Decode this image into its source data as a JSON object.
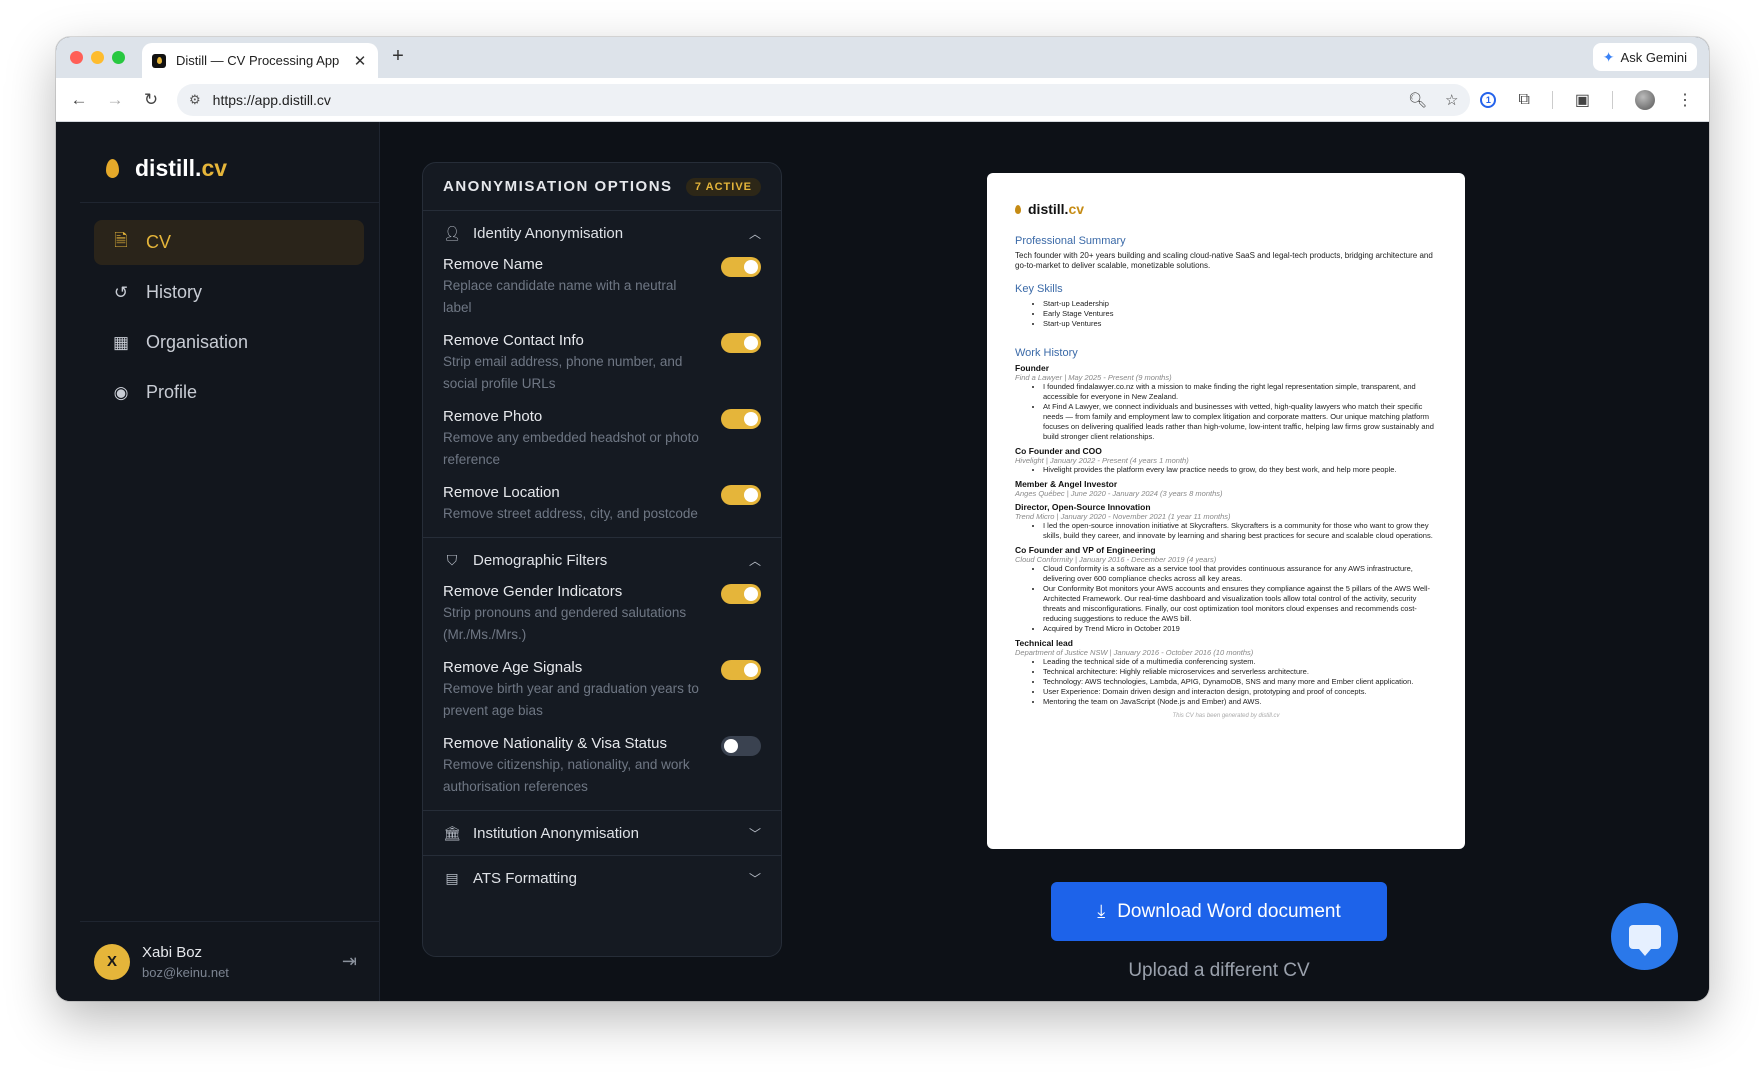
{
  "browser": {
    "tab_title": "Distill — CV Processing App",
    "tab_close": "✕",
    "new_tab": "+",
    "gemini_label": "Ask Gemini",
    "url": "https://app.distill.cv"
  },
  "brand": {
    "name": "distill.",
    "suffix": "cv"
  },
  "sidebar": {
    "items": [
      {
        "label": "CV",
        "icon": "document-icon",
        "active": true
      },
      {
        "label": "History",
        "icon": "history-icon"
      },
      {
        "label": "Organisation",
        "icon": "building-icon"
      },
      {
        "label": "Profile",
        "icon": "user-circle-icon"
      }
    ]
  },
  "user": {
    "initial": "X",
    "name": "Xabi Boz",
    "email": "boz@keinu.net"
  },
  "panel": {
    "title": "ANONYMISATION OPTIONS",
    "badge": "7 ACTIVE",
    "sections": {
      "identity": {
        "label": "Identity Anonymisation",
        "options": [
          {
            "label": "Remove Name",
            "desc": "Replace candidate name with a neutral label",
            "on": true
          },
          {
            "label": "Remove Contact Info",
            "desc": "Strip email address, phone number, and social profile URLs",
            "on": true
          },
          {
            "label": "Remove Photo",
            "desc": "Remove any embedded headshot or photo reference",
            "on": true
          },
          {
            "label": "Remove Location",
            "desc": "Remove street address, city, and postcode",
            "on": true
          }
        ]
      },
      "demographic": {
        "label": "Demographic Filters",
        "options": [
          {
            "label": "Remove Gender Indicators",
            "desc": "Strip pronouns and gendered salutations (Mr./Ms./Mrs.)",
            "on": true
          },
          {
            "label": "Remove Age Signals",
            "desc": "Remove birth year and graduation years to prevent age bias",
            "on": true
          },
          {
            "label": "Remove Nationality & Visa Status",
            "desc": "Remove citizenship, nationality, and work authorisation references",
            "on": false
          }
        ]
      },
      "institution": {
        "label": "Institution Anonymisation"
      },
      "ats": {
        "label": "ATS Formatting"
      }
    }
  },
  "preview": {
    "brand_name": "distill.",
    "brand_suffix": "cv",
    "summary_heading": "Professional Summary",
    "summary": "Tech founder with 20+ years building and scaling cloud-native SaaS and legal-tech products, bridging architecture and go-to-market to deliver scalable, monetizable solutions.",
    "skills_heading": "Key Skills",
    "skills": [
      "Start-up Leadership",
      "Early Stage Ventures",
      "Start-up Ventures"
    ],
    "work_heading": "Work History",
    "roles": [
      {
        "title": "Founder",
        "meta": "Find a Lawyer | May 2025 - Present (9 months)",
        "bullets": [
          "I founded findalawyer.co.nz with a mission to make finding the right legal representation simple, transparent, and accessible for everyone in New Zealand.",
          "At Find A Lawyer, we connect individuals and businesses with vetted, high-quality lawyers who match their specific needs — from family and employment law to complex litigation and corporate matters. Our unique matching platform focuses on delivering qualified leads rather than high-volume, low-intent traffic, helping law firms grow sustainably and build stronger client relationships."
        ]
      },
      {
        "title": "Co Founder and COO",
        "meta": "Hivelight | January 2022 - Present (4 years 1 month)",
        "bullets": [
          "Hivelight provides the platform every law practice needs to grow, do they best work, and help more people."
        ]
      },
      {
        "title": "Member & Angel Investor",
        "meta": "Anges Québec | June 2020 - January 2024 (3 years 8 months)",
        "bullets": []
      },
      {
        "title": "Director, Open-Source Innovation",
        "meta": "Trend Micro | January 2020 - November 2021 (1 year 11 months)",
        "bullets": [
          "I led the open-source innovation initiative at Skycrafters. Skycrafters is a community for those who want to grow they skills, build they career, and innovate by learning and sharing best practices for secure and scalable cloud operations."
        ]
      },
      {
        "title": "Co Founder and VP of Engineering",
        "meta": "Cloud Conformity | January 2016 - December 2019 (4 years)",
        "bullets": [
          "Cloud Conformity is a software as a service tool that provides continuous assurance for any AWS infrastructure, delivering over 600 compliance checks across all key areas.",
          "Our Conformity Bot monitors your AWS accounts and ensures they compliance against the 5 pillars of the AWS Well-Architected Framework. Our real-time dashboard and visualization tools allow total control of the activity, security threats and misconfigurations. Finally, our cost optimization tool monitors cloud expenses and recommends cost-reducing suggestions to reduce the AWS bill.",
          "Acquired by Trend Micro in October 2019"
        ]
      },
      {
        "title": "Technical lead",
        "meta": "Department of Justice NSW | January 2016 - October 2016 (10 months)",
        "bullets": [
          "Leading the technical side of a multimedia conferencing system.",
          "Technical architecture: Highly reliable microservices and serverless architecture.",
          "Technology: AWS technologies, Lambda, APIG, DynamoDB, SNS and many more and Ember client application.",
          "User Experience: Domain driven design and interacton design, prototyping and proof of concepts.",
          "Mentoring the team on JavaScript (Node.js and Ember) and AWS."
        ]
      }
    ],
    "footer": "This CV has been generated by distill.cv"
  },
  "actions": {
    "download_label": "Download Word document",
    "upload_label": "Upload a different CV"
  },
  "colors": {
    "accent": "#e5b53a",
    "primary_button": "#1d63ea",
    "background": "#0d1117"
  }
}
